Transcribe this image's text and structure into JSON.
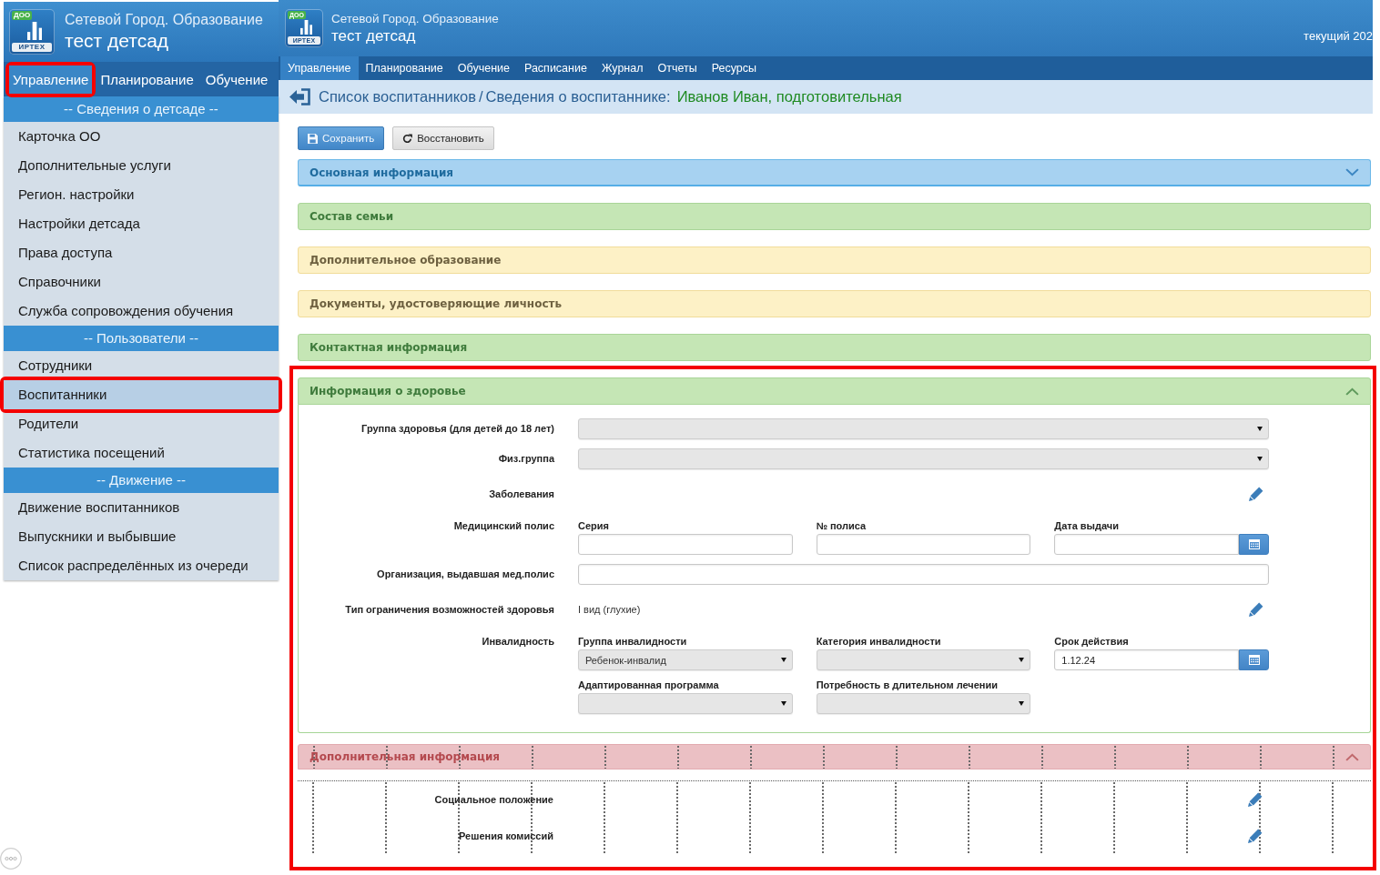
{
  "inset": {
    "logo": {
      "badge": "ДОО",
      "brand": "ИРТЕХ"
    },
    "product": "Сетевой Город. Образование",
    "school": "тест детсад",
    "menu": [
      {
        "label": "Управление",
        "selected": true,
        "highlighted": true
      },
      {
        "label": "Планирование",
        "selected": false,
        "highlighted": false
      },
      {
        "label": "Обучение",
        "selected": false,
        "highlighted": false
      }
    ],
    "sidebar": [
      {
        "title": "-- Сведения о детсаде --",
        "items": [
          {
            "label": "Карточка ОО",
            "selected": false,
            "highlighted": false
          },
          {
            "label": "Дополнительные услуги",
            "selected": false,
            "highlighted": false
          },
          {
            "label": "Регион. настройки",
            "selected": false,
            "highlighted": false
          },
          {
            "label": "Настройки детсада",
            "selected": false,
            "highlighted": false
          },
          {
            "label": "Права доступа",
            "selected": false,
            "highlighted": false
          },
          {
            "label": "Справочники",
            "selected": false,
            "highlighted": false
          },
          {
            "label": "Служба сопровождения обучения",
            "selected": false,
            "highlighted": false
          }
        ]
      },
      {
        "title": "-- Пользователи --",
        "items": [
          {
            "label": "Сотрудники",
            "selected": false,
            "highlighted": false
          },
          {
            "label": "Воспитанники",
            "selected": true,
            "highlighted": true
          },
          {
            "label": "Родители",
            "selected": false,
            "highlighted": false
          },
          {
            "label": "Статистика посещений",
            "selected": false,
            "highlighted": false
          }
        ]
      },
      {
        "title": "-- Движение --",
        "items": [
          {
            "label": "Движение воспитанников",
            "selected": false,
            "highlighted": false
          },
          {
            "label": "Выпускники и выбывшие",
            "selected": false,
            "highlighted": false
          },
          {
            "label": "Список распределённых из очереди",
            "selected": false,
            "highlighted": false
          }
        ]
      }
    ]
  },
  "app": {
    "logo": {
      "badge": "ДОО",
      "brand": "ИРТЕХ"
    },
    "product": "Сетевой Город. Образование",
    "school": "тест детсад",
    "year_label": "текущий 202",
    "menu": [
      {
        "label": "Управление",
        "selected": true
      },
      {
        "label": "Планирование",
        "selected": false
      },
      {
        "label": "Обучение",
        "selected": false
      },
      {
        "label": "Расписание",
        "selected": false
      },
      {
        "label": "Журнал",
        "selected": false
      },
      {
        "label": "Отчеты",
        "selected": false
      },
      {
        "label": "Ресурсы",
        "selected": false
      }
    ],
    "breadcrumb": {
      "parent": "Список воспитанников",
      "separator": "/",
      "page": "Сведения о воспитаннике:",
      "subject": "Иванов Иван, подготовительная"
    },
    "toolbar": [
      {
        "label": "Сохранить",
        "kind": "primary"
      },
      {
        "label": "Восстановить",
        "kind": "secondary"
      }
    ],
    "sections": [
      {
        "title": "Основная информация",
        "kind": "info",
        "expanded": false,
        "chevron": true,
        "highlighted": false,
        "dotted": false
      },
      {
        "title": "Состав семьи",
        "kind": "success",
        "expanded": false,
        "chevron": false,
        "highlighted": false,
        "dotted": false
      },
      {
        "title": "Дополнительное образование",
        "kind": "warning",
        "expanded": false,
        "chevron": false,
        "highlighted": false,
        "dotted": false
      },
      {
        "title": "Документы, удостоверяющие личность",
        "kind": "warning",
        "expanded": false,
        "chevron": false,
        "highlighted": false,
        "dotted": false
      },
      {
        "title": "Контактная информация",
        "kind": "success",
        "expanded": false,
        "chevron": false,
        "highlighted": false,
        "dotted": false
      },
      {
        "title": "Информация о здоровье",
        "kind": "success",
        "expanded": true,
        "chevron": true,
        "highlighted": true,
        "dotted": false,
        "rows": [
          {
            "label": "Группа здоровья (для детей до 18 лет)",
            "kind": "select"
          },
          {
            "label": "Физ.группа",
            "kind": "select"
          },
          {
            "label": "Заболевания",
            "kind": "edit"
          },
          {
            "label": "Медицинский полис",
            "kind": "group",
            "fields": [
              {
                "label": "Серия",
                "kind": "text"
              },
              {
                "label": "№ полиса",
                "kind": "text"
              },
              {
                "label": "Дата выдачи",
                "kind": "date"
              }
            ]
          },
          {
            "label": "Организация, выдавшая мед.полис",
            "kind": "text"
          },
          {
            "label": "Тип ограничения возможностей здоровья",
            "kind": "edit",
            "value": "I вид (глухие)"
          },
          {
            "label": "Инвалидность",
            "kind": "group",
            "fields": [
              {
                "label": "Группа инвалидности",
                "kind": "select",
                "value": "Ребенок-инвалид"
              },
              {
                "label": "Категория инвалидности",
                "kind": "select"
              },
              {
                "label": "Срок действия",
                "kind": "date",
                "value": "1.12.24"
              },
              {
                "label": "Адаптированная программа",
                "kind": "select"
              },
              {
                "label": "Потребность в длительном лечении",
                "kind": "select"
              }
            ]
          }
        ]
      },
      {
        "title": "Дополнительная информация",
        "kind": "danger",
        "expanded": true,
        "chevron": true,
        "highlighted": true,
        "dotted": true,
        "rows": [
          {
            "label": "Социальное положение",
            "kind": "edit"
          },
          {
            "label": "Решения комиссий",
            "kind": "edit"
          }
        ]
      }
    ]
  }
}
